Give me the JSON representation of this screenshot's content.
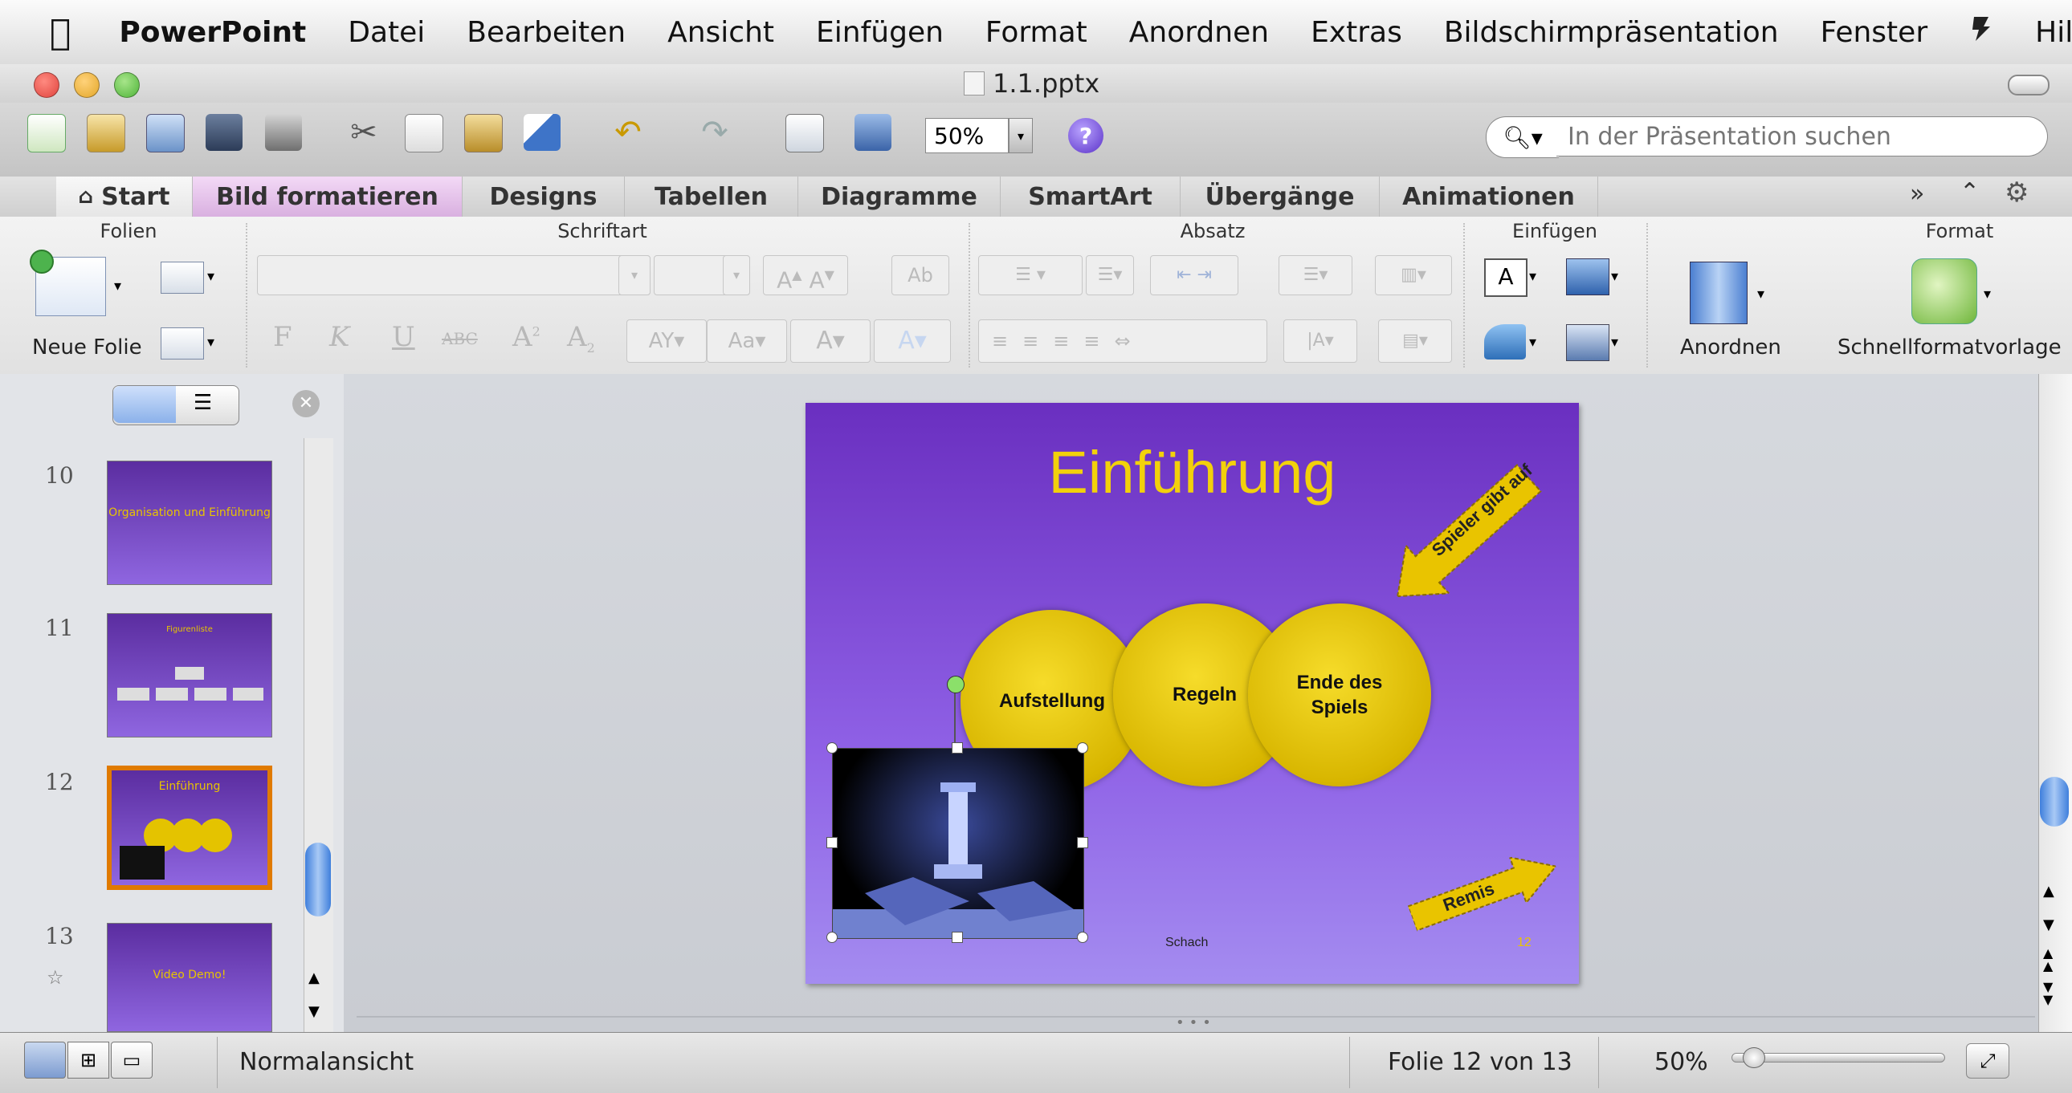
{
  "menubar": {
    "apple_icon": "apple-icon",
    "app_name": "PowerPoint",
    "items": [
      "Datei",
      "Bearbeiten",
      "Ansicht",
      "Einfügen",
      "Format",
      "Anordnen",
      "Extras",
      "Bildschirmpräsentation",
      "Fenster"
    ],
    "script_icon": "script-icon",
    "help_label": "Hilf"
  },
  "window": {
    "title": "1.1.pptx",
    "traffic_lights": {
      "close": "#e0443e",
      "minimize": "#e3a72a",
      "zoom": "#4fb439"
    }
  },
  "toolbar": {
    "zoom_value": "50%",
    "search_placeholder": "In der Präsentation suchen"
  },
  "ribbon_tabs": [
    "Start",
    "Bild formatieren",
    "Designs",
    "Tabellen",
    "Diagramme",
    "SmartArt",
    "Übergänge",
    "Animationen"
  ],
  "ribbon_groups": {
    "folien": {
      "title": "Folien",
      "new_slide_label": "Neue Folie"
    },
    "schriftart": {
      "title": "Schriftart",
      "bold": "F",
      "italic": "K",
      "underline": "U",
      "strike": "ABC"
    },
    "absatz": {
      "title": "Absatz"
    },
    "einfuegen": {
      "title": "Einfügen"
    },
    "format": {
      "title": "Format",
      "arrange_label": "Anordnen",
      "quick_styles_label": "Schnellformatvorlage"
    }
  },
  "slides_panel": {
    "slides": [
      {
        "number": "10",
        "title": "Organisation und Einführung"
      },
      {
        "number": "11",
        "title": "Figurenliste"
      },
      {
        "number": "12",
        "title": "Einführung",
        "selected": true
      },
      {
        "number": "13",
        "title": "Video Demo!"
      }
    ]
  },
  "current_slide": {
    "title": "Einführung",
    "circles": [
      "Aufstellung",
      "Regeln",
      "Ende des Spiels"
    ],
    "arrow_top": "Spieler gibt auf",
    "arrow_bottom": "Remis",
    "footer_center": "Schach",
    "footer_number": "12"
  },
  "statusbar": {
    "view_label": "Normalansicht",
    "slide_counter": "Folie 12 von 13",
    "zoom": "50%"
  },
  "colors": {
    "slide_purple": "#7b47d6",
    "accent_yellow": "#f2d10b",
    "selected_thumb_border": "#e07a00"
  }
}
